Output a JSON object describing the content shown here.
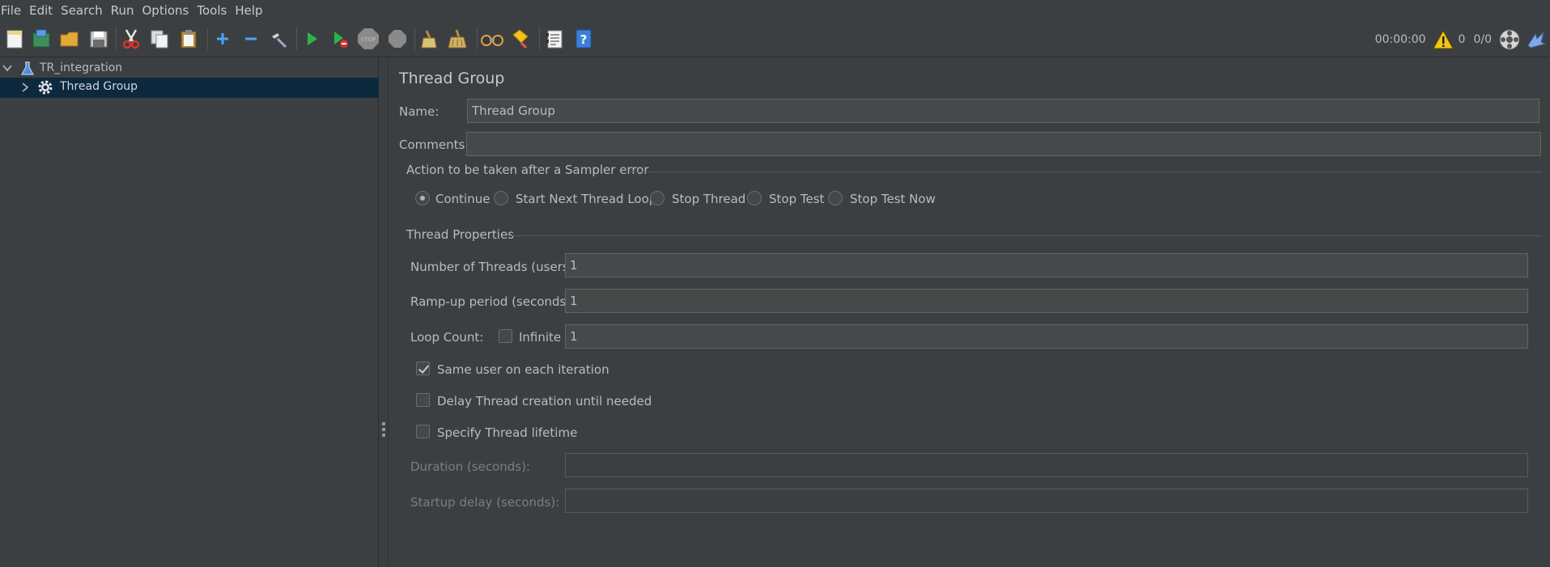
{
  "menu": [
    "File",
    "Edit",
    "Search",
    "Run",
    "Options",
    "Tools",
    "Help"
  ],
  "toolbar": {
    "timer": "00:00:00",
    "warning_count": "0",
    "threads": "0/0"
  },
  "tree": {
    "root": "TR_integration",
    "child": "Thread Group"
  },
  "panel": {
    "title": "Thread Group",
    "name_label": "Name:",
    "name_value": "Thread Group",
    "comments_label": "Comments:",
    "comments_value": "",
    "error_group_title": "Action to be taken after a Sampler error",
    "error_actions": [
      "Continue",
      "Start Next Thread Loop",
      "Stop Thread",
      "Stop Test",
      "Stop Test Now"
    ],
    "selected_action": "Continue",
    "thread_props_title": "Thread Properties",
    "num_threads_label": "Number of Threads (users):",
    "num_threads_value": "1",
    "ramp_up_label": "Ramp-up period (seconds):",
    "ramp_up_value": "1",
    "loop_count_label": "Loop Count:",
    "infinite_label": "Infinite",
    "infinite_checked": false,
    "loop_count_value": "1",
    "same_user_label": "Same user on each iteration",
    "same_user_checked": true,
    "delay_thread_label": "Delay Thread creation until needed",
    "delay_thread_checked": false,
    "specify_lifetime_label": "Specify Thread lifetime",
    "specify_lifetime_checked": false,
    "duration_label": "Duration (seconds):",
    "duration_value": "",
    "startup_delay_label": "Startup delay (seconds):",
    "startup_delay_value": ""
  }
}
